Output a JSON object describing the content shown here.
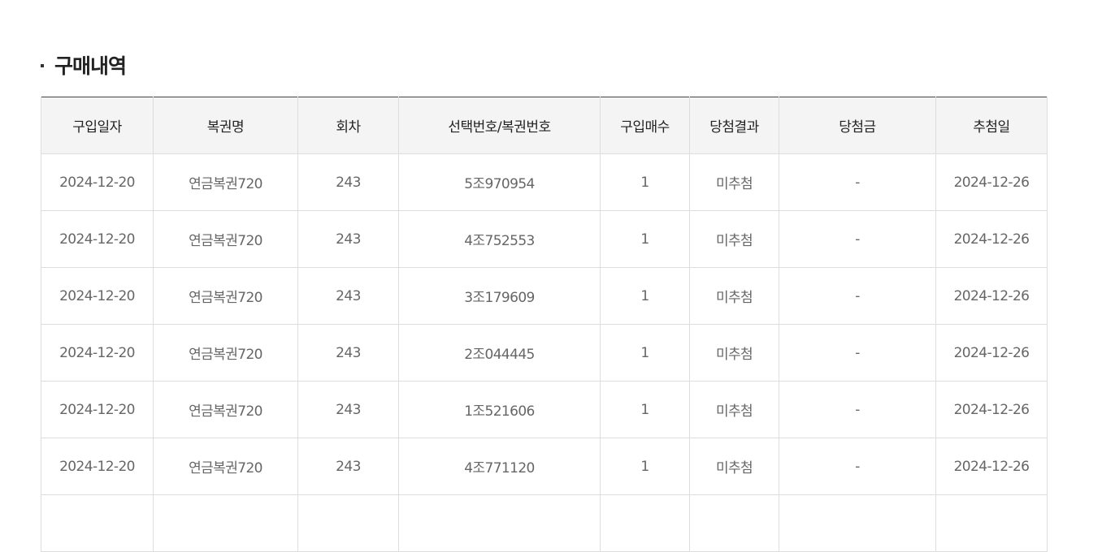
{
  "section": {
    "title": "구매내역"
  },
  "table": {
    "headers": [
      "구입일자",
      "복권명",
      "회차",
      "선택번호/복권번호",
      "구입매수",
      "당첨결과",
      "당첨금",
      "추첨일"
    ],
    "rows": [
      [
        "2024-12-20",
        "연금복권720",
        "243",
        "5조970954",
        "1",
        "미추첨",
        "-",
        "2024-12-26"
      ],
      [
        "2024-12-20",
        "연금복권720",
        "243",
        "4조752553",
        "1",
        "미추첨",
        "-",
        "2024-12-26"
      ],
      [
        "2024-12-20",
        "연금복권720",
        "243",
        "3조179609",
        "1",
        "미추첨",
        "-",
        "2024-12-26"
      ],
      [
        "2024-12-20",
        "연금복권720",
        "243",
        "2조044445",
        "1",
        "미추첨",
        "-",
        "2024-12-26"
      ],
      [
        "2024-12-20",
        "연금복권720",
        "243",
        "1조521606",
        "1",
        "미추첨",
        "-",
        "2024-12-26"
      ],
      [
        "2024-12-20",
        "연금복권720",
        "243",
        "4조771120",
        "1",
        "미추첨",
        "-",
        "2024-12-26"
      ],
      [
        "",
        "",
        "",
        "",
        "",
        "",
        "",
        ""
      ]
    ]
  }
}
